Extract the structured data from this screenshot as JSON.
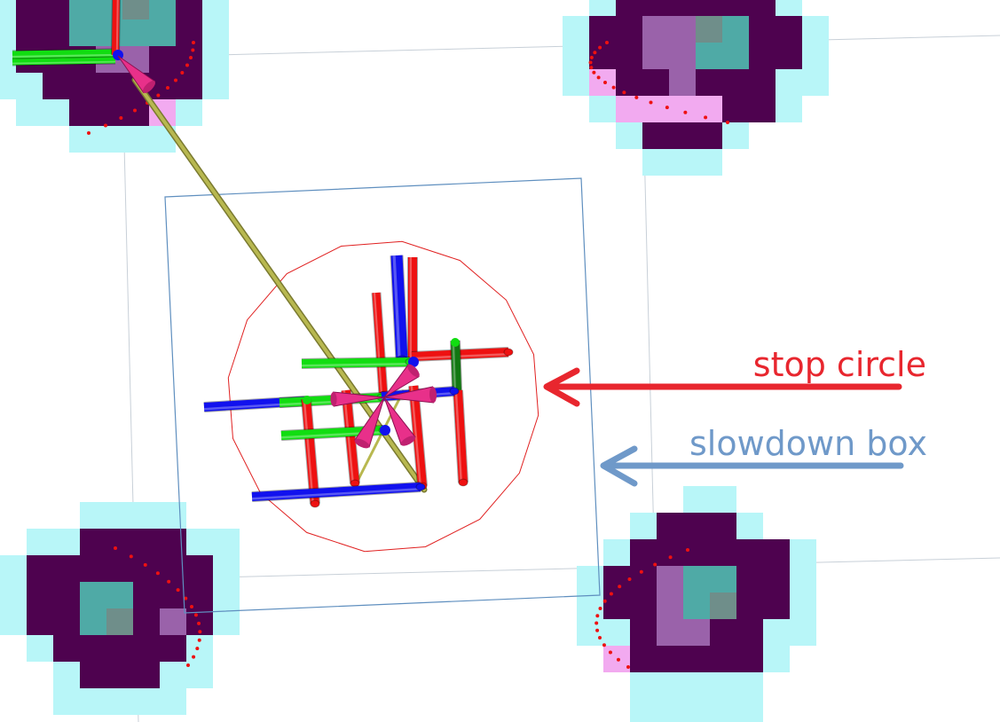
{
  "annotations": {
    "stop_circle": {
      "label": "stop circle",
      "color": "#e8262e"
    },
    "slowdown_box": {
      "label": "slowdown box",
      "color": "#6f99c9"
    }
  },
  "colors": {
    "grid_line": "#c8d0d8",
    "slowdown_box_outline": "#5f8fbf",
    "stop_circle_outline": "#e02020",
    "costmap_inflation": "#b8f6f8",
    "costmap_lethal": "#4e024f",
    "costmap_obstacle": "#4faaa6",
    "costmap_gray": "#6f8e8a",
    "costmap_purple": "#9a62aa",
    "costmap_pink": "#f2aaf0",
    "laser_points": "#ee1111",
    "axis_x": "#ee1111",
    "axis_y": "#11dd11",
    "axis_z": "#1111ee",
    "axis_y_dark": "#117711",
    "pose_arrow": "#e8308a",
    "path_line": "#b8b850"
  },
  "scene": {
    "costmap_blob_count": 4,
    "tf_frame_count": 6,
    "pose_arrow_count": 6
  }
}
